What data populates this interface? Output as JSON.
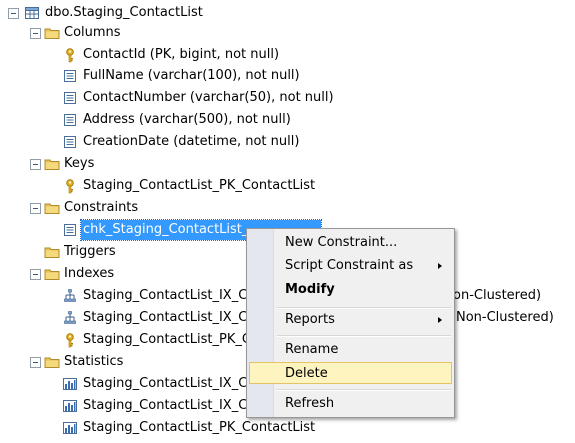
{
  "tree": {
    "table_node": "dbo.Staging_ContactList",
    "columns_folder": "Columns",
    "columns": [
      "ContactId (PK, bigint, not null)",
      "FullName (varchar(100), not null)",
      "ContactNumber (varchar(50), not null)",
      "Address (varchar(500), not null)",
      "CreationDate (datetime, not null)"
    ],
    "keys_folder": "Keys",
    "keys": [
      "Staging_ContactList_PK_ContactList"
    ],
    "constraints_folder": "Constraints",
    "constraints": [
      "chk_Staging_ContactList_"
    ],
    "triggers_folder": "Triggers",
    "indexes_folder": "Indexes",
    "indexes": [
      {
        "name_prefix": "Staging_ContactList_IX_C",
        "suffix": "on-Clustered)"
      },
      {
        "name_prefix": "Staging_ContactList_IX_C",
        "suffix": "Non-Clustered)"
      },
      {
        "name_prefix": "Staging_ContactList_PK_C",
        "suffix": ""
      }
    ],
    "statistics_folder": "Statistics",
    "statistics": [
      "Staging_ContactList_IX_C",
      "Staging_ContactList_IX_C",
      "Staging_ContactList_PK_ContactList"
    ]
  },
  "context_menu": {
    "items": [
      {
        "label": "New Constraint..."
      },
      {
        "label": "Script Constraint as"
      },
      {
        "label": "Modify"
      },
      {
        "label": "Reports"
      },
      {
        "label": "Rename"
      },
      {
        "label": "Delete"
      },
      {
        "label": "Refresh"
      }
    ]
  },
  "colors": {
    "selection": "#3399ff",
    "menu_highlight": "#fdf4bf",
    "menu_highlight_border": "#e5c365",
    "folder": "#e8c25a"
  }
}
